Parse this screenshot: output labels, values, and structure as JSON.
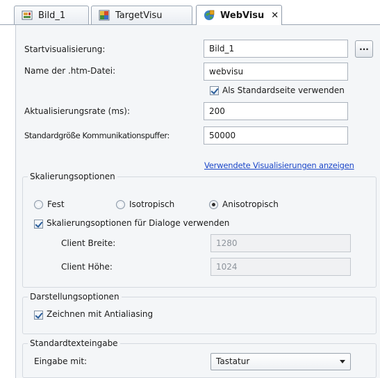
{
  "tabs": [
    {
      "label": "Bild_1",
      "icon": "picture-icon"
    },
    {
      "label": "TargetVisu",
      "icon": "target-visu-icon"
    },
    {
      "label": "WebVisu",
      "icon": "web-visu-icon",
      "active": true,
      "close": "✕"
    }
  ],
  "form": {
    "start_visu": {
      "label": "Startvisualisierung:",
      "value": "Bild_1",
      "browse_label": "..."
    },
    "htm_name": {
      "label": "Name der .htm-Datei:",
      "value": "webvisu"
    },
    "default_page": {
      "label": "Als Standardseite verwenden",
      "checked": true
    },
    "update_rate": {
      "label": "Aktualisierungsrate (ms):",
      "value": "200"
    },
    "buffer_size": {
      "label": "Standardgröße Kommunikationspuffer:",
      "value": "50000"
    },
    "used_visus_link": "Verwendete Visualisierungen anzeigen"
  },
  "scaling": {
    "title": "Skalierungsoptionen",
    "options": [
      {
        "label": "Fest",
        "checked": false
      },
      {
        "label": "Isotropisch",
        "checked": false
      },
      {
        "label": "Anisotropisch",
        "checked": true
      }
    ],
    "dialogs": {
      "label": "Skalierungsoptionen für Dialoge verwenden",
      "checked": true
    },
    "client_width": {
      "label": "Client Breite:",
      "value": "1280"
    },
    "client_height": {
      "label": "Client Höhe:",
      "value": "1024"
    }
  },
  "display": {
    "title": "Darstellungsoptionen",
    "antialiasing": {
      "label": "Zeichnen mit Antialiasing",
      "checked": true
    }
  },
  "text_input": {
    "title": "Standardtexteingabe",
    "label": "Eingabe mit:",
    "selected": "Tastatur"
  },
  "colors": {
    "link": "#1a46c8",
    "panel": "#f4f6f8"
  }
}
